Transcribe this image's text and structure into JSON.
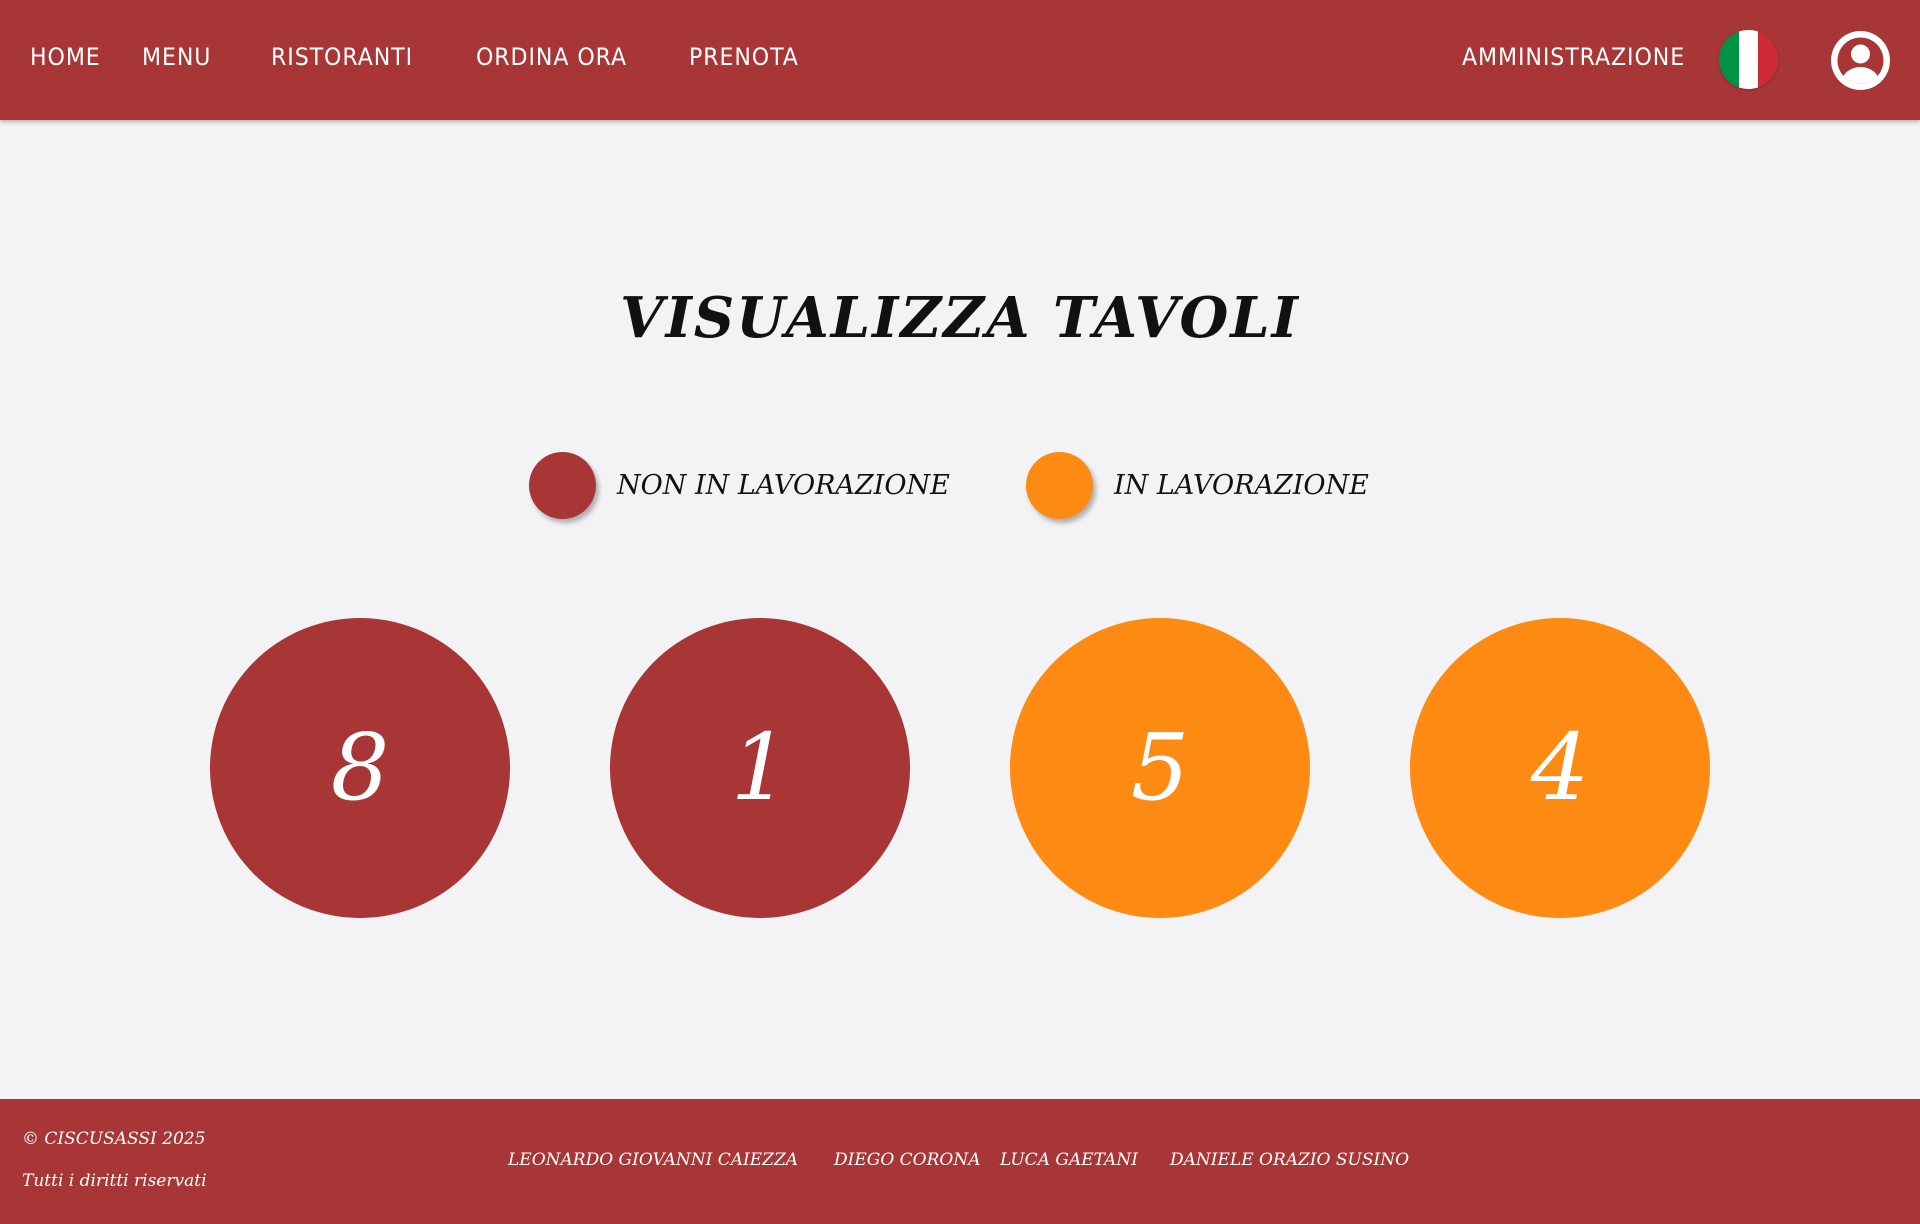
{
  "header": {
    "nav": [
      "HOME",
      "MENU",
      "RISTORANTI",
      "ORDINA ORA",
      "PRENOTA"
    ],
    "admin_label": "AMMINISTRAZIONE",
    "language_flag_icon": "italy-flag-icon",
    "user_icon": "user-account-icon",
    "flag_colors": [
      "#009246",
      "#ffffff",
      "#ce2b37"
    ]
  },
  "main": {
    "title": "VISUALIZZA TAVOLI",
    "legend": [
      {
        "label": "NON IN LAVORAZIONE",
        "color": "#a83636"
      },
      {
        "label": "IN LAVORAZIONE",
        "color": "#fd8a12"
      }
    ],
    "tables": [
      {
        "number": "8",
        "status": "non in lavorazione",
        "color": "#a83636"
      },
      {
        "number": "1",
        "status": "non in lavorazione",
        "color": "#a83636"
      },
      {
        "number": "5",
        "status": "in lavorazione",
        "color": "#fd8a12"
      },
      {
        "number": "4",
        "status": "in lavorazione",
        "color": "#fd8a12"
      }
    ]
  },
  "footer": {
    "copyright": "© CISCUSASSI 2025",
    "rights": "Tutti i diritti riservati",
    "authors": [
      "LEONARDO GIOVANNI CAIEZZA",
      "DIEGO CORONA",
      "LUCA GAETANI",
      "DANIELE ORAZIO SUSINO"
    ]
  },
  "colors": {
    "brand_red": "#a83636",
    "accent_orange": "#fd8a12",
    "background": "#f3f3f5"
  }
}
